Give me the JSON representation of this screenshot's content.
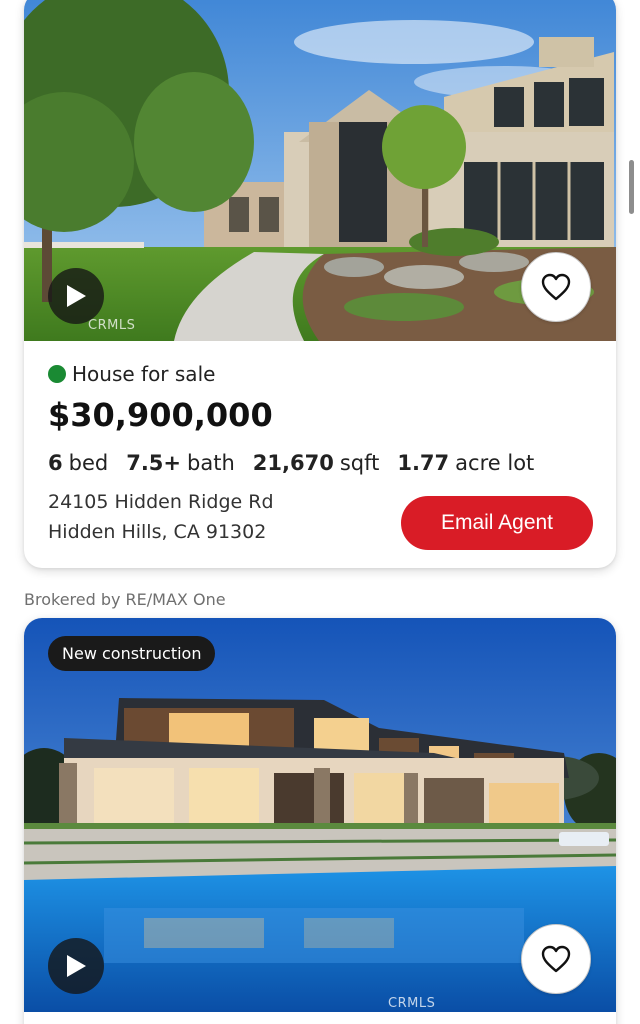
{
  "listing1": {
    "status": "House for sale",
    "price": "$30,900,000",
    "beds": "6",
    "beds_label": "bed",
    "baths": "7.5+",
    "baths_label": "bath",
    "sqft": "21,670",
    "sqft_label": "sqft",
    "lot": "1.77",
    "lot_label": "acre lot",
    "address_line1": "24105 Hidden Ridge Rd",
    "address_line2": "Hidden Hills, CA 91302",
    "cta": "Email Agent",
    "watermark": "CRMLS",
    "icons": {
      "play": "play-icon",
      "favorite": "heart-icon"
    }
  },
  "broker": "Brokered by RE/MAX One",
  "listing2": {
    "badge": "New construction",
    "watermark": "CRMLS",
    "icons": {
      "play": "play-icon",
      "favorite": "heart-icon"
    }
  },
  "colors": {
    "status_green": "#1a8a33",
    "cta_red": "#d91c26",
    "badge_bg": "#1a1a1a"
  }
}
